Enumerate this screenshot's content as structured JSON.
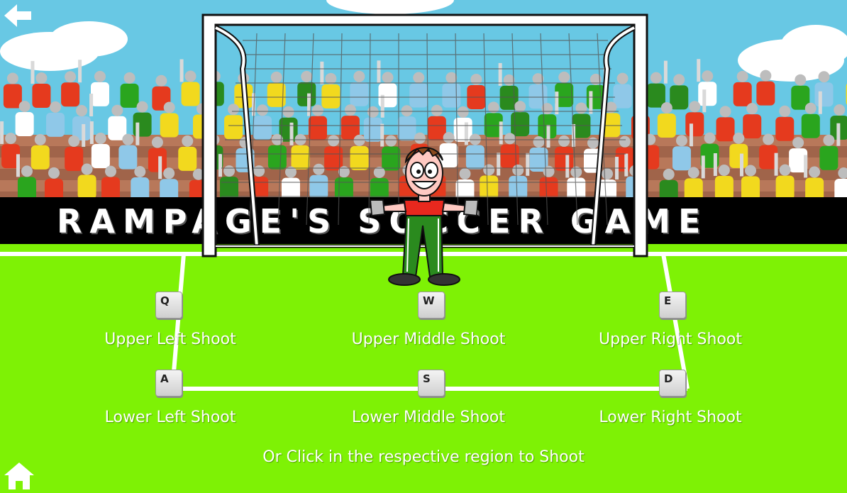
{
  "game": {
    "title": "RAMPAGE'S SOCCER GAME"
  },
  "controls": [
    {
      "key": "Q",
      "label": "Upper Left Shoot"
    },
    {
      "key": "W",
      "label": "Upper Middle Shoot"
    },
    {
      "key": "E",
      "label": "Upper Right Shoot"
    },
    {
      "key": "A",
      "label": "Lower Left Shoot"
    },
    {
      "key": "S",
      "label": "Lower Middle Shoot"
    },
    {
      "key": "D",
      "label": "Lower Right Shoot"
    }
  ],
  "hint": "Or Click in the respective region to Shoot",
  "icons": {
    "back": "arrow-left-icon",
    "home": "home-icon"
  },
  "colors": {
    "pitch": "#7ef205",
    "sky": "#68c8e4",
    "banner": "#000000",
    "keeper_shirt": "#e8281e",
    "keeper_pants": "#2a8a1e"
  }
}
